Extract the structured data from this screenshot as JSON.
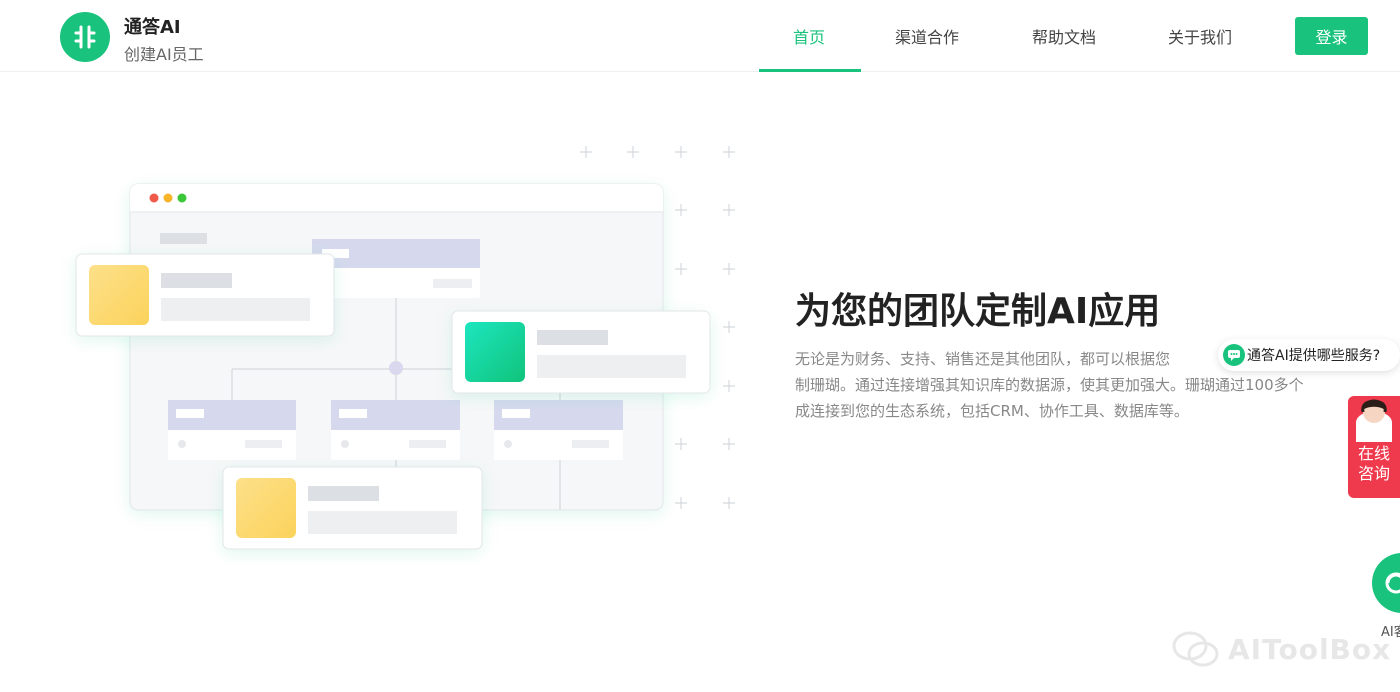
{
  "brand": {
    "name": "通答AI",
    "tagline": "创建AI员工"
  },
  "nav": {
    "items": [
      {
        "label": "首页",
        "active": true
      },
      {
        "label": "渠道合作",
        "active": false
      },
      {
        "label": "帮助文档",
        "active": false
      },
      {
        "label": "关于我们",
        "active": false
      }
    ],
    "login_label": "登录"
  },
  "hero": {
    "title": "为您的团队定制AI应用",
    "description_lines": [
      "无论是为财务、支持、销售还是其他团队，都可以根据您",
      "制珊瑚。通过连接增强其知识库的数据源，使其更加强大。珊瑚通过100多个",
      "成连接到您的生态系统，包括CRM、协作工具、数据库等。"
    ]
  },
  "widgets": {
    "faq_bubble": "通答AI提供哪些服务?",
    "consult_lines": [
      "在线",
      "咨询"
    ],
    "ai_label": "AI客"
  },
  "watermark": "AIToolBox",
  "colors": {
    "accent": "#19c37d",
    "consult": "#ef3a4d"
  },
  "icons": {
    "logo": "brain-logo-icon",
    "faq": "chat-bubble-icon",
    "ai": "ai-assistant-icon",
    "watermark": "wechat-icon"
  }
}
